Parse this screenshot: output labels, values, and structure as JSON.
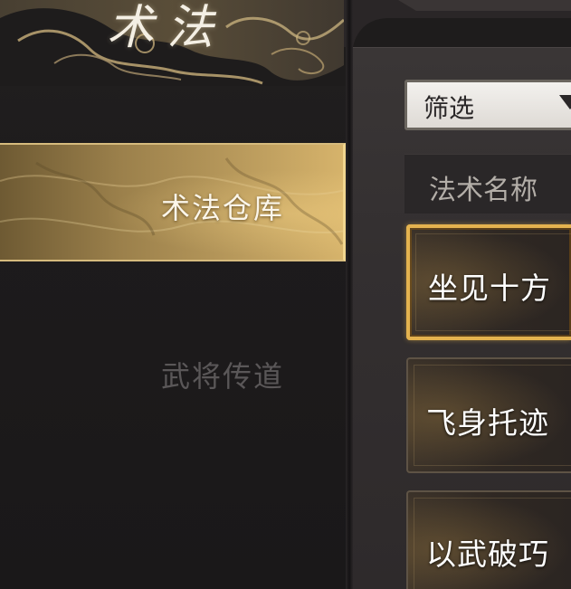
{
  "header": {
    "title": "术法"
  },
  "nav": {
    "items": [
      {
        "label": "术法仓库",
        "active": true
      },
      {
        "label": "武将传道",
        "active": false
      }
    ]
  },
  "filter": {
    "label": "筛选",
    "icon": "funnel-icon"
  },
  "list": {
    "header": "法术名称",
    "items": [
      {
        "name": "坐见十方",
        "selected": true
      },
      {
        "name": "飞身托迹",
        "selected": false
      },
      {
        "name": "以武破巧",
        "selected": false
      }
    ]
  },
  "colors": {
    "accent_gold": "#e4b34f",
    "active_tab_gold": "#b99a5c",
    "background": "#1c1a1b",
    "inactive_text": "#5a5758"
  }
}
